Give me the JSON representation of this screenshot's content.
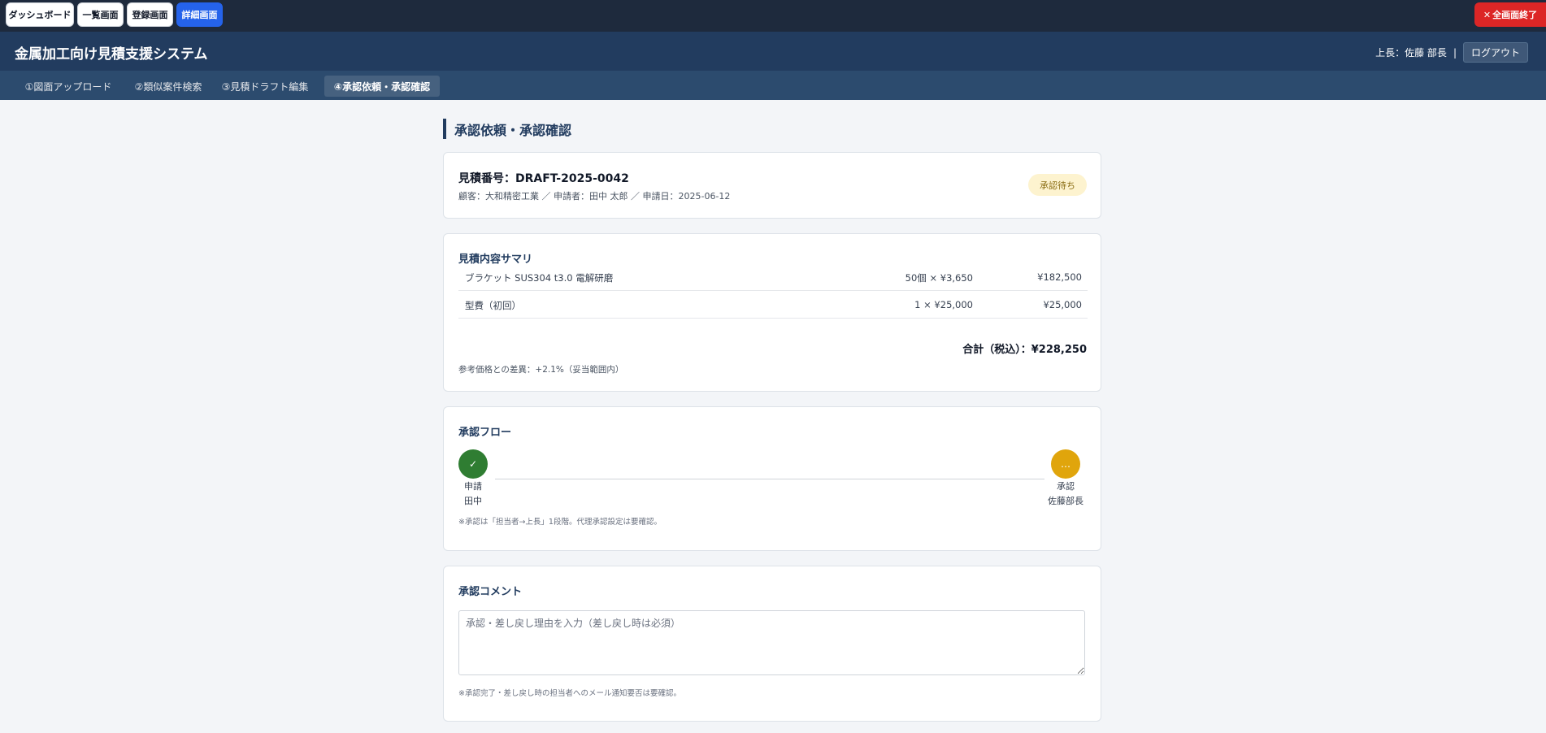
{
  "topnav": {
    "buttons": [
      {
        "label": "ダッシュボード"
      },
      {
        "label": "一覧画面"
      },
      {
        "label": "登録画面"
      },
      {
        "label": "詳細画面",
        "active": true
      }
    ],
    "close_label": "全画面終了",
    "close_icon": "close-icon"
  },
  "header": {
    "title": "金属加工向け見積支援システム",
    "user_label": "上長：佐藤 部長",
    "separator": "|",
    "logout_label": "ログアウト"
  },
  "steps": [
    {
      "label": "①図面アップロード"
    },
    {
      "label": "②類似案件検索"
    },
    {
      "label": "③見積ドラフト編集"
    },
    {
      "label": "④承認依頼・承認確認",
      "active": true
    }
  ],
  "page": {
    "title": "承認依頼・承認確認"
  },
  "quote": {
    "number_label": "見積番号：DRAFT-2025-0042",
    "meta": "顧客：大和精密工業 ／ 申請者：田中 太郎 ／ 申請日：2025-06-12",
    "status": "承認待ち"
  },
  "summary": {
    "title": "見積内容サマリ",
    "items": [
      {
        "name": "ブラケット SUS304 t3.0 電解研磨",
        "qty": "50個 × ¥3,650",
        "amount": "¥182,500"
      },
      {
        "name": "型費（初回）",
        "qty": "1 × ¥25,000",
        "amount": "¥25,000"
      }
    ],
    "total": "合計（税込）：¥228,250",
    "diff_note": "参考価格との差異：+2.1%（妥当範囲内）"
  },
  "flow": {
    "title": "承認フロー",
    "steps": [
      {
        "icon": "✓",
        "role": "申請",
        "person": "田中"
      },
      {
        "icon": "…",
        "role": "承認",
        "person": "佐藤部長"
      }
    ],
    "note": "※承認は「担当者→上長」1段階。代理承認設定は要確認。"
  },
  "comment": {
    "title": "承認コメント",
    "placeholder": "承認・差し戻し理由を入力（差し戻し時は必須）",
    "note": "※承認完了・差し戻し時の担当者へのメール通知要否は要確認。"
  },
  "colors": {
    "topbar": "#1e2a3d",
    "header": "#223c5f",
    "steps_bar": "#2c4b6e",
    "active_button": "#2563eb",
    "close_button": "#dc2626",
    "done": "#2f7d32",
    "waiting": "#e0a50c",
    "badge_bg": "#fdf3cf"
  }
}
